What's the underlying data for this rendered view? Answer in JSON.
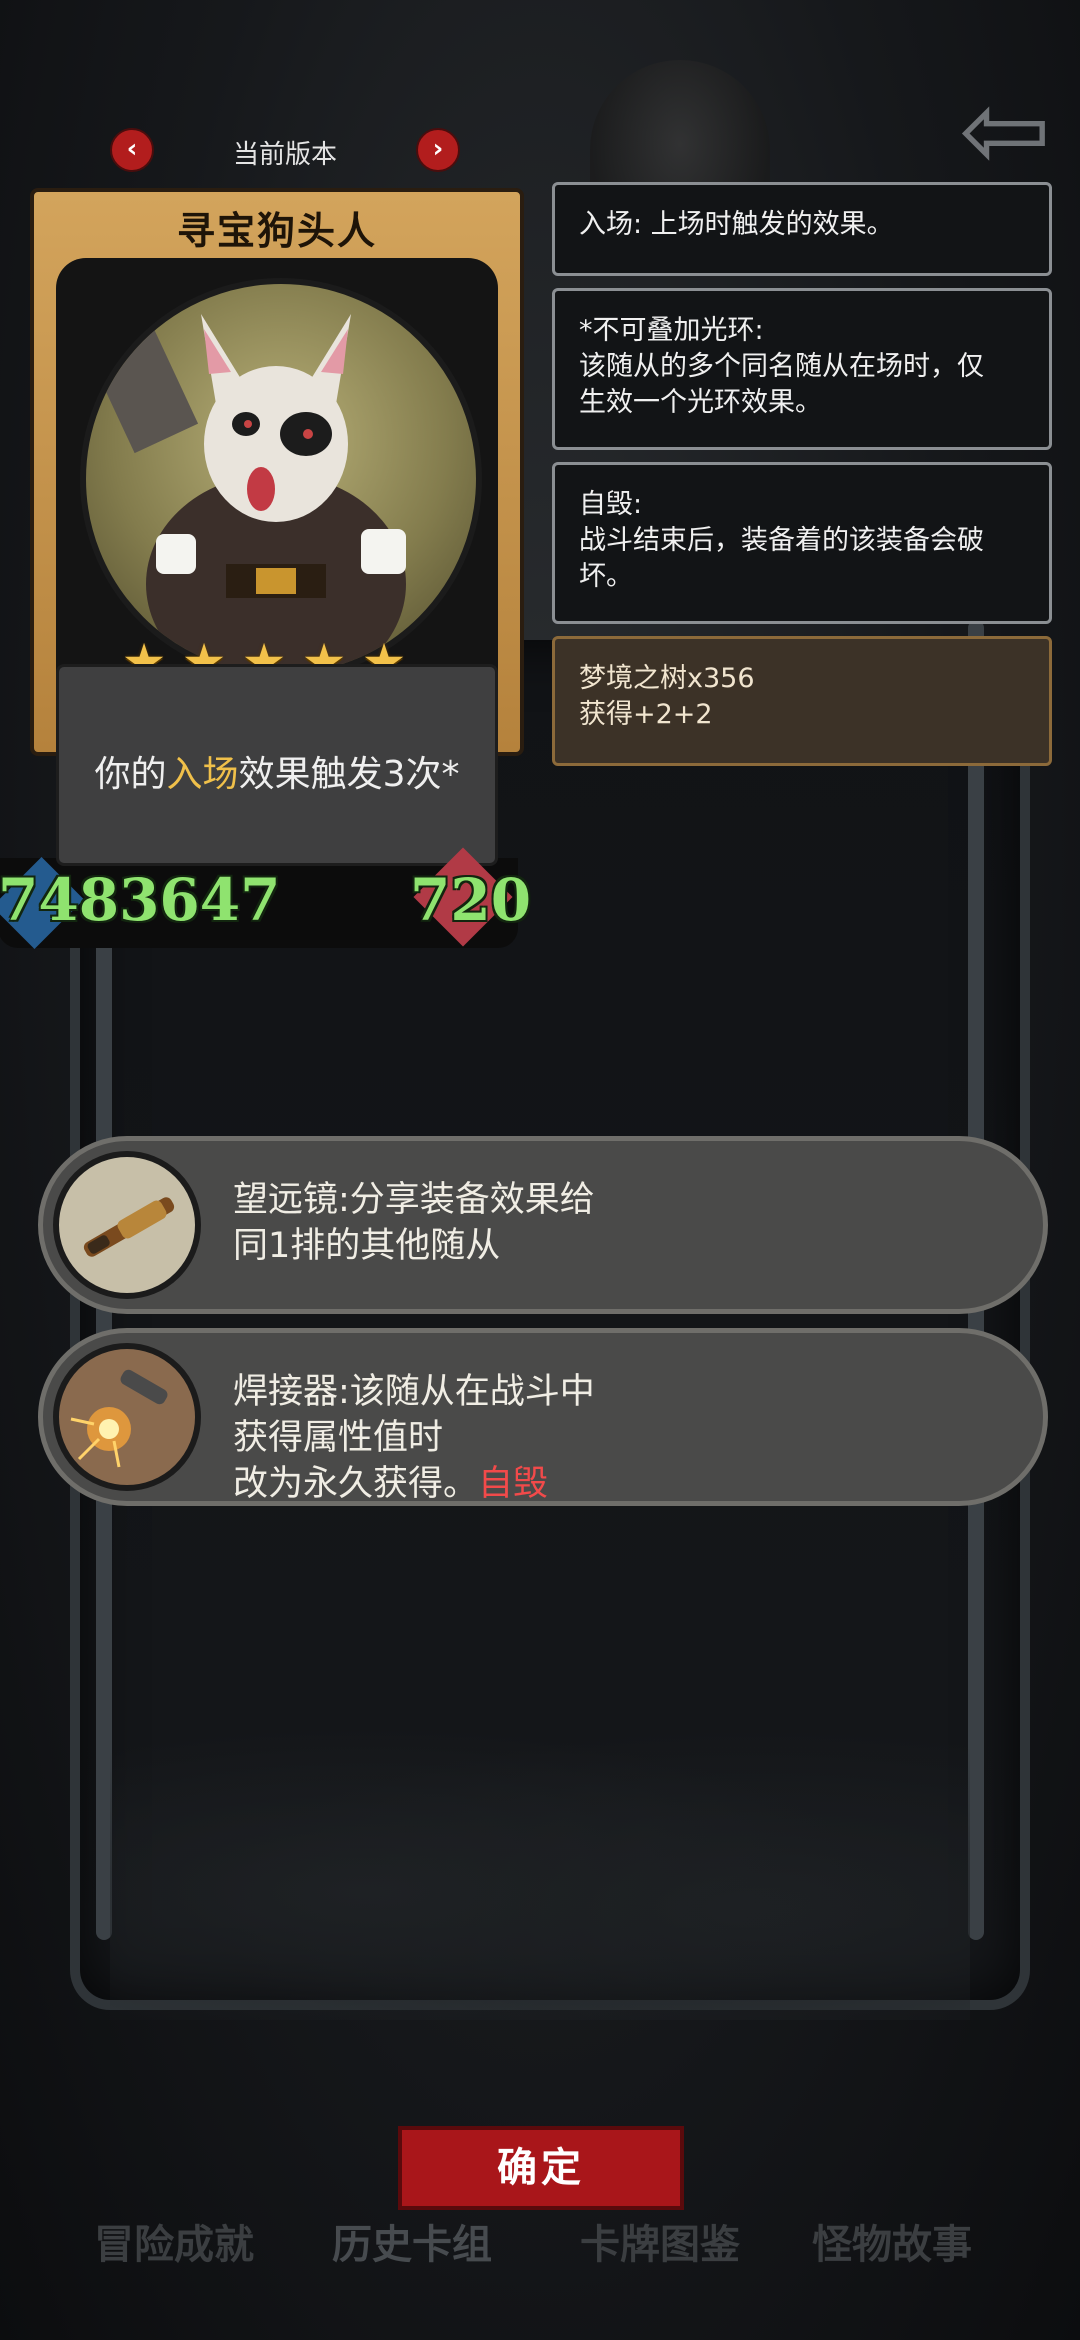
{
  "version_nav": {
    "label": "当前版本",
    "prev_icon": "chevron-left-icon",
    "next_icon": "chevron-right-icon"
  },
  "back_icon": "back-arrow-icon",
  "card": {
    "name": "寻宝狗头人",
    "stars": 5,
    "effect_prefix": "你的",
    "effect_keyword": "入场",
    "effect_suffix": "效果触发3次*",
    "attack": "7483647",
    "health": "720"
  },
  "tooltips": [
    {
      "lines": [
        "入场: 上场时触发的效果。"
      ]
    },
    {
      "lines": [
        "*不可叠加光环:",
        "该随从的多个同名随从在场时，仅",
        "生效一个光环效果。"
      ]
    },
    {
      "lines": [
        "自毁:",
        "战斗结束后，装备着的该装备会破",
        "坏。"
      ]
    },
    {
      "lines": [
        "梦境之树x356",
        "获得+2+2"
      ]
    }
  ],
  "equipment": [
    {
      "icon": "telescope-icon",
      "lines": [
        "望远镜:分享装备效果给",
        "同1排的其他随从"
      ]
    },
    {
      "icon": "welder-icon",
      "lines": [
        "焊接器:该随从在战斗中",
        "获得属性值时",
        "改为永久获得。"
      ],
      "tag": "自毁"
    }
  ],
  "confirm_label": "确定",
  "bottom_tabs": [
    "冒险成就",
    "历史卡组",
    "卡牌图鉴",
    "怪物故事"
  ],
  "colors": {
    "keyword": "#f0c04a",
    "self_destruct": "#f24a4a",
    "stat_green": "#8fe36f",
    "confirm_red": "#a9161a"
  }
}
